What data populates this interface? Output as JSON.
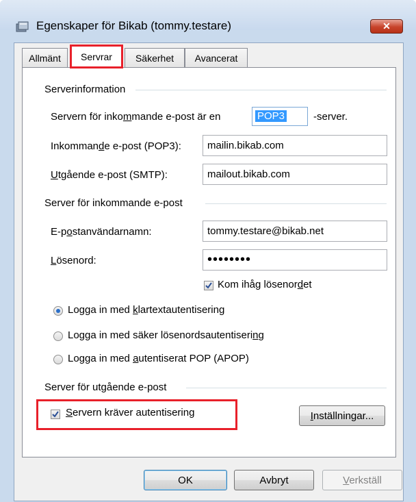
{
  "window": {
    "title": "Egenskaper för Bikab (tommy.testare)",
    "close_label": "✕"
  },
  "tabs": [
    {
      "label": "Allmänt"
    },
    {
      "label": "Servrar"
    },
    {
      "label": "Säkerhet"
    },
    {
      "label": "Avancerat"
    }
  ],
  "server_info": {
    "group_label": "Serverinformation",
    "incoming_type_prefix": "Servern för inkommande e-post är en",
    "incoming_type_value": "POP3",
    "incoming_type_suffix": "-server.",
    "incoming_label": "Inkommande e-post (POP3):",
    "incoming_value": "mailin.bikab.com",
    "outgoing_label": "Utgående e-post (SMTP):",
    "outgoing_value": "mailout.bikab.com"
  },
  "incoming_server": {
    "group_label": "Server för inkommande e-post",
    "username_label": "E-postanvändarnamn:",
    "username_value": "tommy.testare@bikab.net",
    "password_label": "Lösenord:",
    "password_value": "••••••••",
    "remember_label": "Kom ihåg lösenordet",
    "remember_checked": true,
    "auth_options": [
      {
        "label": "Logga in med klartextautentisering",
        "selected": true
      },
      {
        "label": "Logga in med säker lösenordsautentisering",
        "selected": false
      },
      {
        "label": "Logga in med autentiserat POP (APOP)",
        "selected": false
      }
    ]
  },
  "outgoing_server": {
    "group_label": "Server för utgående e-post",
    "requires_auth_label": "Servern kräver autentisering",
    "requires_auth_checked": true,
    "settings_button": "Inställningar..."
  },
  "footer": {
    "ok": "OK",
    "cancel": "Avbryt",
    "apply": "Verkställ"
  },
  "colors": {
    "highlight": "#e8202a",
    "selection": "#3399ff"
  }
}
